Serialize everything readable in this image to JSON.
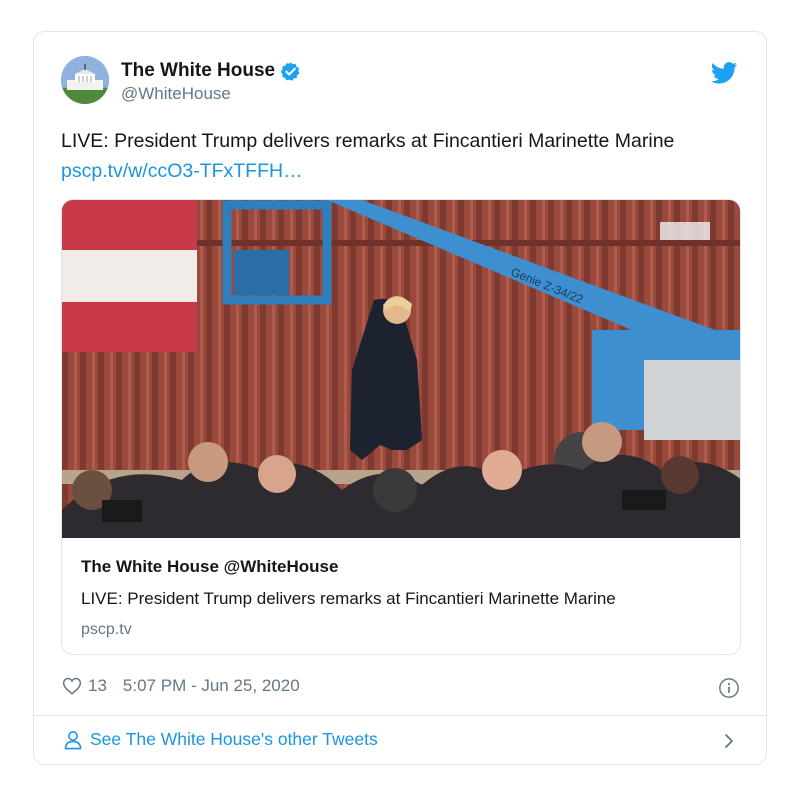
{
  "tweet": {
    "author_name": "The White House",
    "author_handle": "@WhiteHouse",
    "text": "LIVE: President Trump delivers remarks at Fincantieri Marinette Marine",
    "link_text": "pscp.tv/w/ccO3-TFxTFFH…",
    "likes": "13",
    "timestamp": "5:07 PM - Jun 25, 2020"
  },
  "link_card": {
    "title": "The White House @WhiteHouse",
    "description": "LIVE: President Trump delivers remarks at Fincantieri Marinette Marine",
    "domain": "pscp.tv",
    "image_text": "Genie Z-34/22"
  },
  "footer": {
    "other_tweets_label": "See The White House's other Tweets"
  },
  "colors": {
    "link": "#1b95e0",
    "secondary_text": "#657786",
    "border": "#e1e8ed",
    "verified": "#1da1f2"
  },
  "icons": [
    "verified-badge-icon",
    "twitter-bird-icon",
    "heart-icon",
    "info-icon",
    "person-icon",
    "chevron-right-icon"
  ]
}
